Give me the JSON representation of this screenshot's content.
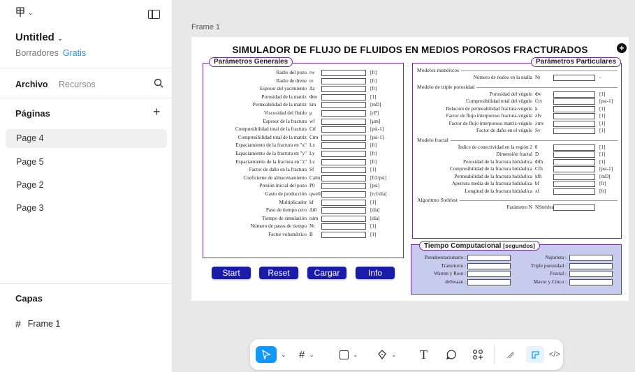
{
  "sidebar": {
    "file_title": "Untitled",
    "drafts": "Borradores",
    "plan": "Gratis",
    "tab_file": "Archivo",
    "tab_assets": "Recursos",
    "pages_title": "Páginas",
    "pages": [
      "Page 4",
      "Page 5",
      "Page 2",
      "Page 3"
    ],
    "active_page": "Page 4",
    "layers_title": "Capas",
    "layers": [
      "Frame 1"
    ]
  },
  "canvas": {
    "frame_label": "Frame 1",
    "title": "SIMULADOR DE FLUJO DE FLUIDOS EN MEDIOS POROSOS FRACTURADOS",
    "general": {
      "label": "Parámetros Generales",
      "params": [
        {
          "label": "Radio del pozo",
          "sym": "rw",
          "unit": "[ft]"
        },
        {
          "label": "Radio de drene",
          "sym": "re",
          "unit": "[ft]"
        },
        {
          "label": "Espesor del yacimiento",
          "sym": "Δz",
          "unit": "[ft]"
        },
        {
          "label": "Porosidad de la matriz",
          "sym": "Φm",
          "unit": "[1]"
        },
        {
          "label": "Permeabilidad de la matriz",
          "sym": "km",
          "unit": "[mD]"
        },
        {
          "label": "Viscosidad del fluido",
          "sym": "μ",
          "unit": "[cP]"
        },
        {
          "label": "Espesor de la fractura",
          "sym": "wf",
          "unit": "[μm]"
        },
        {
          "label": "Compresibilidad total de la fractura",
          "sym": "Ctf",
          "unit": "[psi-1]"
        },
        {
          "label": "Compresibilidad total de la matriz",
          "sym": "Ctm",
          "unit": "[psi-1]"
        },
        {
          "label": "Espaciamiento de la fractura en \"x\"",
          "sym": "Lx",
          "unit": "[ft]"
        },
        {
          "label": "Espaciamiento de la fractura en \"y\"",
          "sym": "Ly",
          "unit": "[ft]"
        },
        {
          "label": "Espaciamiento de la fractura en \"z\"",
          "sym": "Lz",
          "unit": "[ft]"
        },
        {
          "label": "Factor de daño en la fractura",
          "sym": "Sf",
          "unit": "[1]"
        },
        {
          "label": "Coeficiente de almacenamiento",
          "sym": "Calm",
          "unit": "[ft3/psi]"
        },
        {
          "label": "Presión inicial del pozo",
          "sym": "P0",
          "unit": "[psi]"
        },
        {
          "label": "Gasto de producción",
          "sym": "qwell",
          "unit": "[rcf/día]"
        },
        {
          "label": "Multiplicador",
          "sym": "kf",
          "unit": "[1]"
        },
        {
          "label": "Paso de tiempo cero",
          "sym": "Δt0",
          "unit": "[día]"
        },
        {
          "label": "Tiempo de simulación",
          "sym": "tsim",
          "unit": "[día]"
        },
        {
          "label": "Número de pasos de tiempo",
          "sym": "Nt",
          "unit": "[1]"
        },
        {
          "label": "Factor volumétrico",
          "sym": "B",
          "unit": "[1]"
        }
      ]
    },
    "particular": {
      "label": "Parámetros Particulares",
      "sections": [
        {
          "title": "Modelos numéricos",
          "params": [
            {
              "label": "Número de nodos en la malla",
              "sym": "Nr",
              "unit": "-"
            }
          ]
        },
        {
          "title": "Modelo de triple porosidad",
          "params": [
            {
              "label": "Porosidad del vúgulo",
              "sym": "Φv",
              "unit": "[1]"
            },
            {
              "label": "Compresibilidad total del vúgulo",
              "sym": "Ctv",
              "unit": "[psi-1]"
            },
            {
              "label": "Relación de permeabilidad fractura-vúgulo",
              "sym": "k",
              "unit": "[1]"
            },
            {
              "label": "Factor de flujo interporoso fractura-vúgulo",
              "sym": "λfv",
              "unit": "[1]"
            },
            {
              "label": "Factor de flujo interporoso matriz-vúgulo",
              "sym": "λmv",
              "unit": "[1]"
            },
            {
              "label": "Factor de daño en el vúgulo",
              "sym": "Sv",
              "unit": "[1]"
            }
          ]
        },
        {
          "title": "Modelo fractal",
          "params": [
            {
              "label": "Índice de conectividad en la región 2",
              "sym": "θ",
              "unit": "[1]"
            },
            {
              "label": "Dimensión fractal",
              "sym": "D",
              "unit": "[1]"
            },
            {
              "label": "Porosidad de la fractura hidráulica",
              "sym": "Φfh",
              "unit": "[1]"
            },
            {
              "label": "Compresibilidad de la fractura hidráulica",
              "sym": "Cfh",
              "unit": "[psi-1]"
            },
            {
              "label": "Permeabilidad de la fractura hidráulica",
              "sym": "kfh",
              "unit": "[mD]"
            },
            {
              "label": "Apertura media de la fractura hidráulica",
              "sym": "bf",
              "unit": "[ft]"
            },
            {
              "label": "Longitud de la fractura hidráulica",
              "sym": "xf",
              "unit": "[ft]"
            }
          ]
        },
        {
          "title": "Algoritmo Stehfest",
          "params": [
            {
              "label": "Parámetro N",
              "sym": "NStehfest",
              "unit": ""
            }
          ]
        }
      ]
    },
    "buttons": [
      "Start",
      "Reset",
      "Cargar",
      "Info"
    ],
    "time": {
      "label": "Tiempo Computacional",
      "unit": "[segundos]",
      "left": [
        "Pseudoestacionario :",
        "Transitorio :",
        "Warren y Root :",
        "deSwaan :"
      ],
      "right": [
        "Najurieta :",
        "Triple porosidad :",
        "Fractal :",
        "Mavor y Cinco :"
      ]
    }
  },
  "toolbar": {
    "tools": [
      "move-tool",
      "frame-tool",
      "shape-tool",
      "pen-tool",
      "text-tool",
      "comment-tool",
      "actions-tool",
      "draw-mode",
      "design-mode",
      "dev-mode"
    ]
  },
  "colors": {
    "accent": "#0d99ff",
    "button": "#1a1ba8",
    "frame_border": "#6b2f95",
    "time_bg": "#c7ccef"
  }
}
